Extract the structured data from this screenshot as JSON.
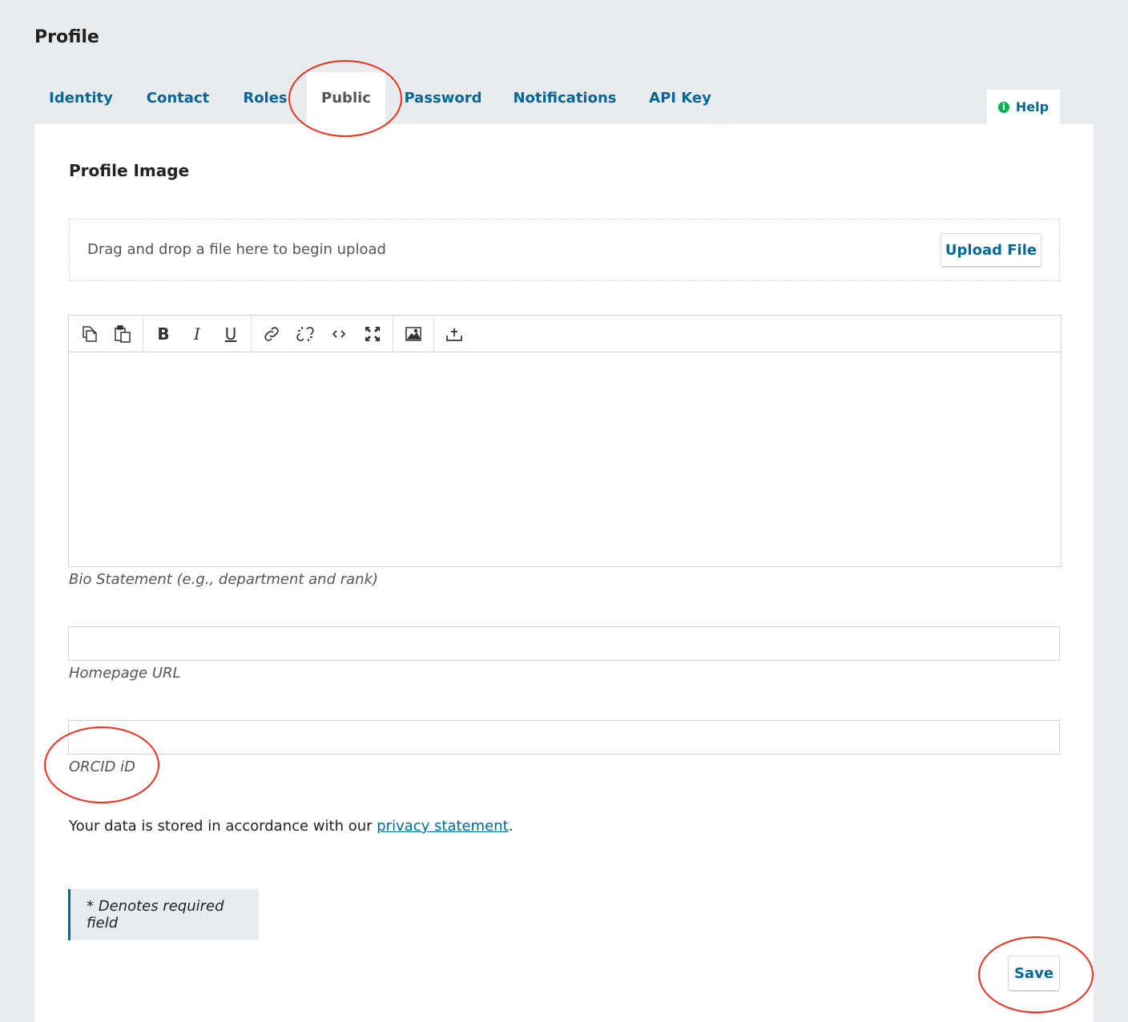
{
  "page": {
    "title": "Profile"
  },
  "tabs": [
    {
      "label": "Identity"
    },
    {
      "label": "Contact"
    },
    {
      "label": "Roles"
    },
    {
      "label": "Public"
    },
    {
      "label": "Password"
    },
    {
      "label": "Notifications"
    },
    {
      "label": "API Key"
    }
  ],
  "active_tab": "Public",
  "help": {
    "label": "Help",
    "icon": "info-icon"
  },
  "profile_image": {
    "heading": "Profile Image",
    "dropzone_text": "Drag and drop a file here to begin upload",
    "upload_label": "Upload File"
  },
  "editor": {
    "toolbar": [
      [
        "copy-icon",
        "paste-icon"
      ],
      [
        "bold-icon",
        "italic-icon",
        "underline-icon"
      ],
      [
        "link-icon",
        "unlink-icon",
        "code-icon",
        "fullscreen-icon"
      ],
      [
        "image-icon"
      ],
      [
        "upload-icon"
      ]
    ],
    "label": "Bio Statement (e.g., department and rank)",
    "value": ""
  },
  "homepage": {
    "label": "Homepage URL",
    "value": ""
  },
  "orcid": {
    "label": "ORCID iD",
    "value": ""
  },
  "privacy": {
    "prefix": "Your data is stored in accordance with our ",
    "link": "privacy statement",
    "suffix": "."
  },
  "required_note": "* Denotes required field",
  "save_label": "Save",
  "colors": {
    "accent": "#006798",
    "page_bg": "#e9ecee",
    "annotation": "#e8321f",
    "help_icon": "#00b24e"
  }
}
